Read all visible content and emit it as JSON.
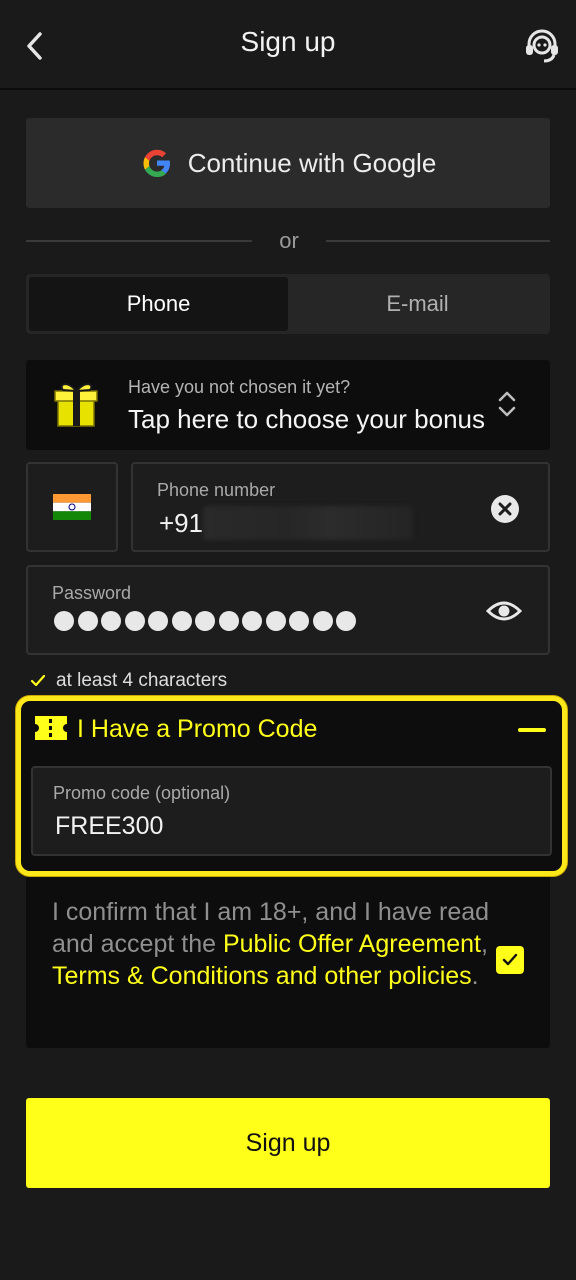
{
  "header": {
    "title": "Sign up",
    "back_icon": "chevron-left-icon",
    "support_icon": "headset-icon"
  },
  "google": {
    "label": "Continue with Google",
    "icon": "google-icon"
  },
  "divider": {
    "text": "or"
  },
  "tabs": [
    {
      "label": "Phone",
      "active": true
    },
    {
      "label": "E-mail",
      "active": false
    }
  ],
  "bonus": {
    "subtitle": "Have you not chosen it yet?",
    "main": "Tap here to choose your bonus",
    "icon": "gift-icon"
  },
  "phone": {
    "label": "Phone number",
    "prefix": "+91",
    "flag": "india-flag-icon"
  },
  "password": {
    "label": "Password",
    "dot_count": 13,
    "icon": "eye-icon"
  },
  "password_hint": {
    "text": "at least 4 characters",
    "met": true
  },
  "promo": {
    "title": "I Have a Promo Code",
    "field_label": "Promo code (optional)",
    "value": "FREE300",
    "expanded": true
  },
  "terms": {
    "text_plain": "I confirm that I am 18+, and I have read and accept the ",
    "link1": "Public Offer Agreement",
    "sep1": ", ",
    "link2": "Terms & Conditions",
    "sep2": " and ",
    "link3": "other policies",
    "end": ".",
    "checked": true
  },
  "signup": {
    "label": "Sign up"
  },
  "colors": {
    "accent": "#ffff1a",
    "background": "#1a1a1a",
    "panel": "#0d0d0d"
  }
}
